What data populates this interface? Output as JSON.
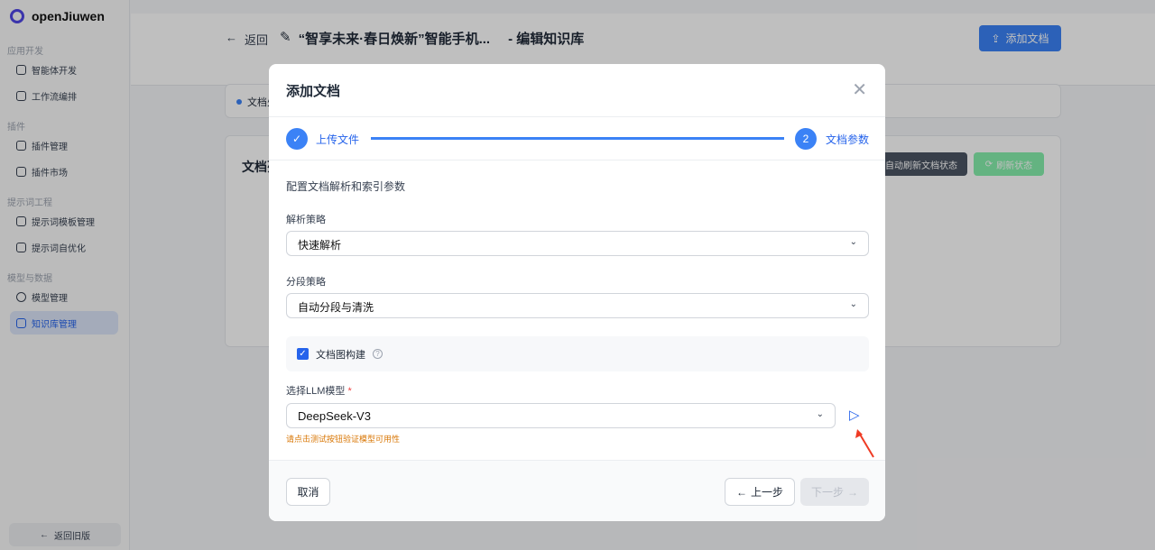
{
  "brand": "openJiuwen",
  "sidebar": {
    "sections": [
      {
        "title": "应用开发",
        "items": [
          "智能体开发",
          "工作流编排"
        ]
      },
      {
        "title": "插件",
        "items": [
          "插件管理",
          "插件市场"
        ]
      },
      {
        "title": "提示词工程",
        "items": [
          "提示词模板管理",
          "提示词自优化"
        ]
      },
      {
        "title": "模型与数据",
        "items": [
          "模型管理",
          "知识库管理"
        ]
      }
    ],
    "back_old": "返回旧版"
  },
  "header": {
    "back": "返回",
    "title": "“智享未来·春日焕新”智能手机...",
    "suffix": "- 编辑知识库",
    "add_doc": "添加文档"
  },
  "page": {
    "card1_text": "文档处",
    "card2_title": "文档列",
    "auto_refresh": "自动刷新文档状态",
    "refresh": "刷新状态"
  },
  "modal": {
    "title": "添加文档",
    "steps": [
      {
        "num": "1",
        "label": "上传文件"
      },
      {
        "num": "2",
        "label": "文档参数"
      }
    ],
    "intro": "配置文档解析和索引参数",
    "parse_label": "解析策略",
    "parse_value": "快速解析",
    "segment_label": "分段策略",
    "segment_value": "自动分段与清洗",
    "graph_label": "文档图构建",
    "graph_checked": true,
    "llm_label": "选择LLM模型",
    "required": "*",
    "llm_value": "DeepSeek-V3",
    "hint": "请点击测试按钮验证模型可用性",
    "cancel": "取消",
    "prev": "上一步",
    "next": "下一步"
  }
}
